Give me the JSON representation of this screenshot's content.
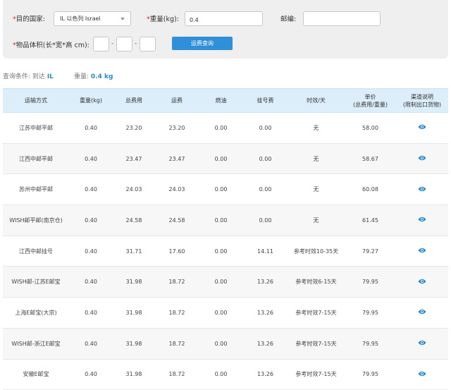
{
  "form": {
    "country_label": "目的国家:",
    "country_value": "IL  以色列  Israel",
    "weight_label": "重量(kg):",
    "weight_value": "0.4",
    "zipcode_label": "邮编:",
    "zipcode_value": "",
    "volume_label": "物品体积(长*宽*高 cm):",
    "required_mark": "*",
    "separator": "-",
    "search_button": "运费查询"
  },
  "condition": {
    "label": "查询条件:",
    "dest_label": "到达",
    "dest_value": "IL",
    "weight_label": "重量:",
    "weight_value": "0.4 kg"
  },
  "table": {
    "headers": [
      "运输方式",
      "重量(kg)",
      "总费用",
      "运费",
      "燃油",
      "挂号费",
      "时效/天",
      "单价\n(总费用/重量)",
      "渠道说明\n(限制出口货物)"
    ],
    "rows": [
      {
        "method": "江苏中邮平邮",
        "weight": "0.40",
        "total": "23.20",
        "freight": "23.20",
        "fuel": "0.00",
        "reg": "0.00",
        "time": "无",
        "unit": "58.00"
      },
      {
        "method": "江西中邮平邮",
        "weight": "0.40",
        "total": "23.47",
        "freight": "23.47",
        "fuel": "0.00",
        "reg": "0.00",
        "time": "无",
        "unit": "58.67"
      },
      {
        "method": "苏州中邮平邮",
        "weight": "0.40",
        "total": "24.03",
        "freight": "24.03",
        "fuel": "0.00",
        "reg": "0.00",
        "time": "无",
        "unit": "60.08"
      },
      {
        "method": "WISH邮平邮(南京仓)",
        "weight": "0.40",
        "total": "24.58",
        "freight": "24.58",
        "fuel": "0.00",
        "reg": "0.00",
        "time": "无",
        "unit": "61.45"
      },
      {
        "method": "江西中邮挂号",
        "weight": "0.40",
        "total": "31.71",
        "freight": "17.60",
        "fuel": "0.00",
        "reg": "14.11",
        "time": "参考时效10-35天",
        "unit": "79.27"
      },
      {
        "method": "WISH邮-江苏E邮宝",
        "weight": "0.40",
        "total": "31.98",
        "freight": "18.72",
        "fuel": "0.00",
        "reg": "13.26",
        "time": "参考时效6-15天",
        "unit": "79.95"
      },
      {
        "method": "上海E邮宝(大宗)",
        "weight": "0.40",
        "total": "31.98",
        "freight": "18.72",
        "fuel": "0.00",
        "reg": "13.26",
        "time": "参考时效7-15天",
        "unit": "79.95"
      },
      {
        "method": "WISH邮-浙江E邮宝",
        "weight": "0.40",
        "total": "31.98",
        "freight": "18.72",
        "fuel": "0.00",
        "reg": "13.26",
        "time": "参考时效7-15天",
        "unit": "79.95"
      },
      {
        "method": "安徽E邮宝",
        "weight": "0.40",
        "total": "31.98",
        "freight": "18.72",
        "fuel": "0.00",
        "reg": "13.26",
        "time": "参考时效7-15天",
        "unit": "79.95"
      }
    ]
  },
  "colors": {
    "accent": "#2f8fd8",
    "required": "#e0201f",
    "header_bg": "#dbeefa",
    "eye_icon": "#1e88d2"
  }
}
